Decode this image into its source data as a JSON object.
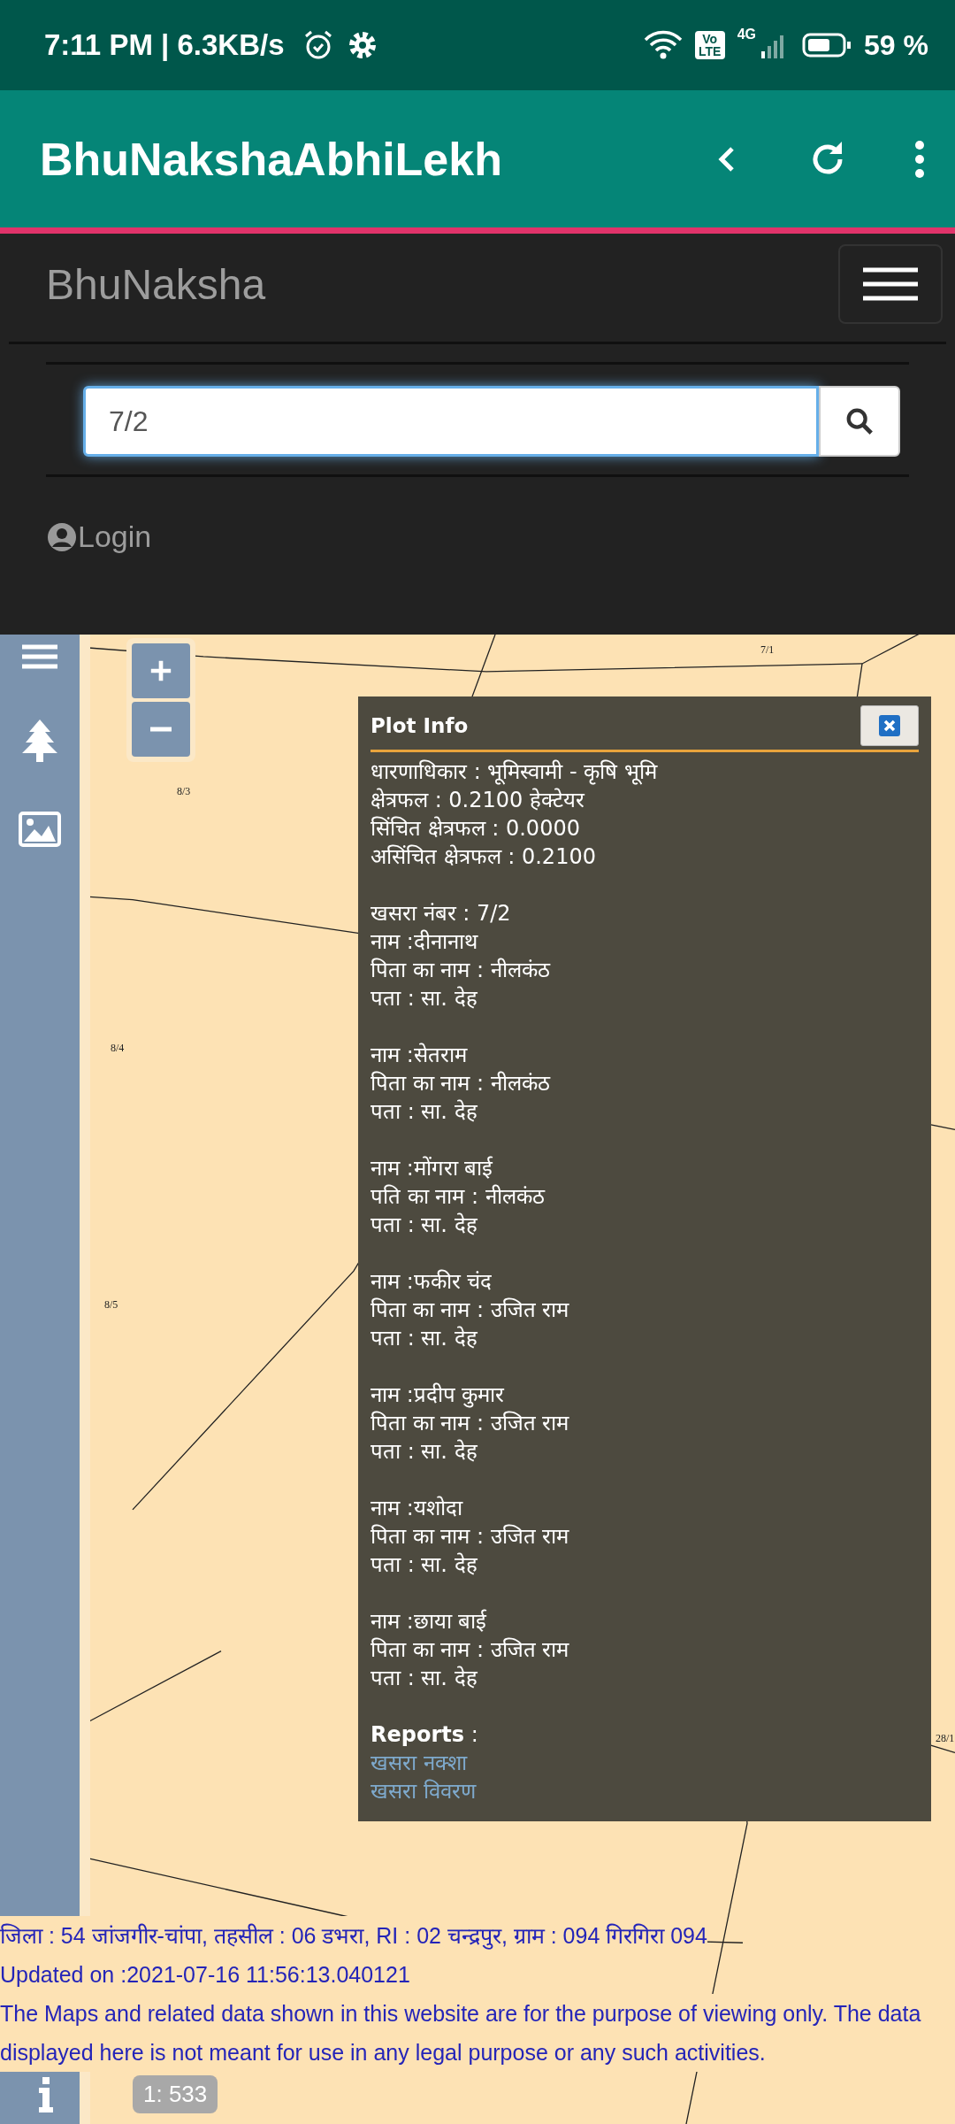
{
  "status_bar": {
    "time": "7:11 PM | 6.3KB/s",
    "volte": "Vo LTE",
    "network": "4G",
    "battery": "59 %"
  },
  "app_bar": {
    "title": "BhuNakshaAbhiLekh"
  },
  "navbar": {
    "brand": "BhuNaksha",
    "search": {
      "value": "7/2"
    },
    "login": "Login"
  },
  "map": {
    "labels": [
      "8/3",
      "7/1",
      "8/4",
      "8/5",
      "28/1"
    ],
    "scale": "1: 533"
  },
  "plot_info": {
    "title": "Plot Info",
    "summary": [
      "धारणाधिकार : भूमिस्वामी - कृषि भूमि",
      "क्षेत्रफल : 0.2100 हेक्टेयर",
      "सिंचित क्षेत्रफल : 0.0000",
      "असिंचित क्षेत्रफल : 0.2100"
    ],
    "khasra": "खसरा नंबर : 7/2",
    "owners": [
      {
        "name": "नाम :दीनानाथ",
        "relation": "पिता का नाम : नीलकंठ",
        "address": "पता : सा. देह"
      },
      {
        "name": "नाम :सेतराम",
        "relation": "पिता का नाम : नीलकंठ",
        "address": "पता : सा. देह"
      },
      {
        "name": "नाम :मोंगरा बाई",
        "relation": "पति का नाम : नीलकंठ",
        "address": "पता : सा. देह"
      },
      {
        "name": "नाम :फकीर चंद",
        "relation": "पिता का नाम : उजित राम",
        "address": "पता : सा. देह"
      },
      {
        "name": "नाम :प्रदीप कुमार",
        "relation": "पिता का नाम : उजित राम",
        "address": "पता : सा. देह"
      },
      {
        "name": "नाम :यशोदा",
        "relation": "पिता का नाम : उजित राम",
        "address": "पता : सा. देह"
      },
      {
        "name": "नाम :छाया बाई",
        "relation": "पिता का नाम : उजित राम",
        "address": "पता : सा. देह"
      }
    ],
    "reports_label": "**Reports** :",
    "report_links": [
      "खसरा नक्शा",
      "खसरा विवरण"
    ]
  },
  "footer": {
    "location": "जिला : 54 जांजगीर-चांपा, तहसील : 06 डभरा, RI : 02 चन्द्रपुर, ग्राम : 094 गिरगिरा 094",
    "updated": "Updated on :2021-07-16 11:56:13.040121",
    "disclaimer": "The Maps and related data shown in this website are for the purpose of viewing only. The data displayed here is not meant for use in any legal purpose or any such activities."
  }
}
